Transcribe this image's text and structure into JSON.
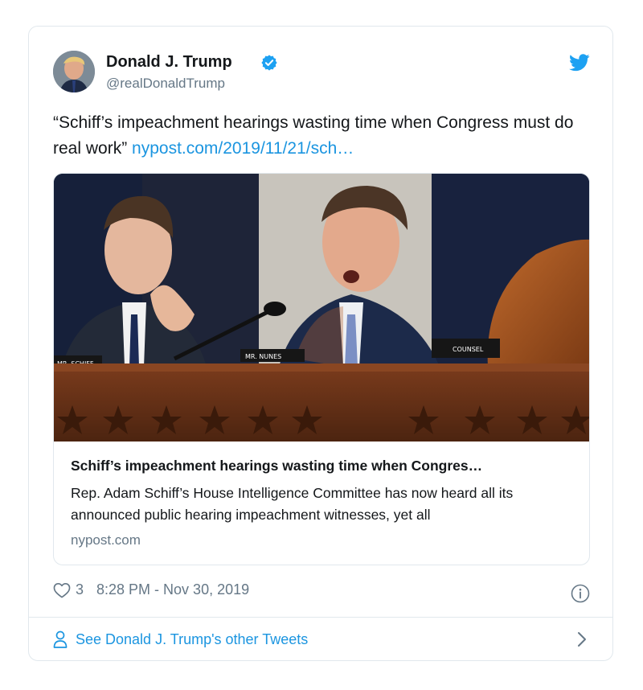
{
  "tweet": {
    "author_name": "Donald J. Trump",
    "handle": "@realDonaldTrump",
    "text": "“Schiff’s impeachment hearings wasting time when Congress must do real work” ",
    "link_text": "nypost.com/2019/11/21/sch…",
    "likes": "3",
    "timestamp": "8:28 PM - Nov 30, 2019",
    "footer_link": "See Donald J. Trump's other Tweets"
  },
  "card": {
    "title": "Schiff’s impeachment hearings wasting time when Congres…",
    "description": "Rep. Adam Schiff’s House Intelligence Committee has now heard all its announced public hearing impeachment witnesses, yet all",
    "domain": "nypost.com",
    "nameplates": [
      "MR. SCHIFF",
      "MR. NUNES",
      "COUNSEL"
    ]
  },
  "icons": {
    "verified": "verified-badge-icon",
    "bird": "twitter-bird-icon",
    "heart": "heart-icon",
    "info": "info-icon",
    "person": "person-icon",
    "chevron": "chevron-right-icon"
  },
  "colors": {
    "accent": "#1b95e0",
    "verified": "#1da1f2",
    "secondary_text": "#657786",
    "border": "#e1e8ed"
  }
}
